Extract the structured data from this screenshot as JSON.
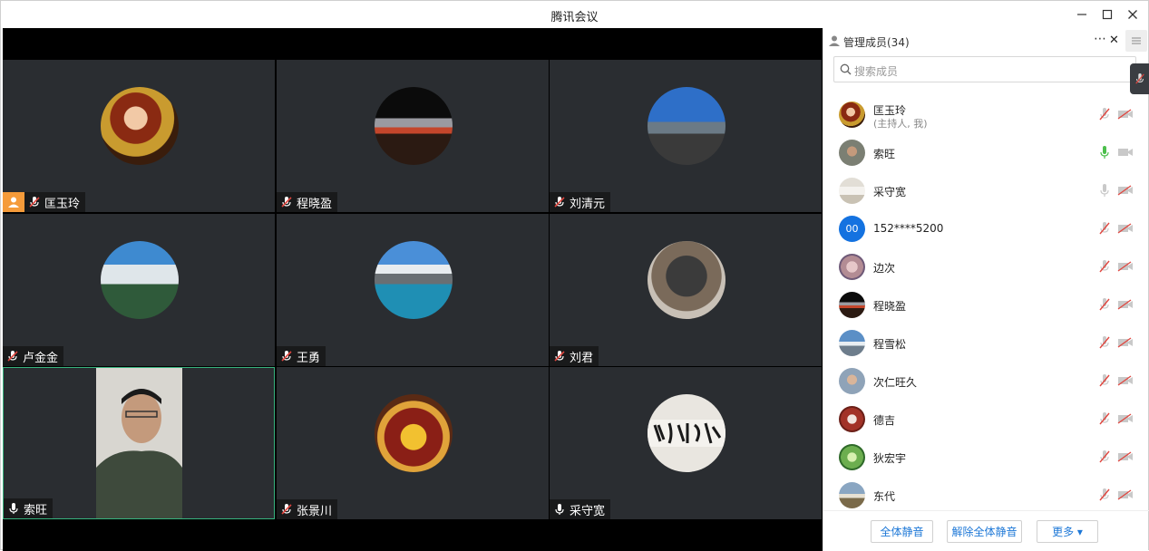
{
  "window": {
    "title": "腾讯会议"
  },
  "tiles": [
    {
      "name": "匡玉玲",
      "host": true,
      "mic": "muted",
      "avatar": "opera-portrait"
    },
    {
      "name": "程晓盈",
      "host": false,
      "mic": "muted",
      "avatar": "palace-night"
    },
    {
      "name": "刘清元",
      "host": false,
      "mic": "muted",
      "avatar": "yak-lake"
    },
    {
      "name": "卢金金",
      "host": false,
      "mic": "muted",
      "avatar": "mountain-waterfall"
    },
    {
      "name": "王勇",
      "host": false,
      "mic": "muted",
      "avatar": "glacier-lake"
    },
    {
      "name": "刘君",
      "host": false,
      "mic": "muted",
      "avatar": "bronze-statue"
    },
    {
      "name": "索旺",
      "host": false,
      "mic": "on",
      "avatar": "live-video",
      "active": true
    },
    {
      "name": "张景川",
      "host": false,
      "mic": "muted",
      "avatar": "buddha-figure"
    },
    {
      "name": "采守宽",
      "host": false,
      "mic": "on",
      "avatar": "calligraphy"
    }
  ],
  "panel": {
    "title": "管理成员(34)",
    "more_label": "⋯",
    "close_label": "✕",
    "search_placeholder": "搜索成员",
    "members": [
      {
        "name": "匡玉玲",
        "sub": "(主持人, 我)",
        "mic": "muted",
        "avatar_color": "#6a3a1e"
      },
      {
        "name": "索旺",
        "sub": "",
        "mic": "active",
        "avatar_color": "#7b7f73"
      },
      {
        "name": "采守宽",
        "sub": "",
        "mic": "off-gray",
        "avatar_color": "#c9c2b4"
      },
      {
        "name": "152****5200",
        "sub": "",
        "mic": "muted",
        "avatar_color": "#1472e0",
        "avatar_text": "00"
      },
      {
        "name": "边次",
        "sub": "",
        "mic": "muted",
        "avatar_color": "#b38c94"
      },
      {
        "name": "程晓盈",
        "sub": "",
        "mic": "muted",
        "avatar_color": "#3b2a22"
      },
      {
        "name": "程雪松",
        "sub": "",
        "mic": "muted",
        "avatar_color": "#5b8fc6"
      },
      {
        "name": "次仁旺久",
        "sub": "",
        "mic": "muted",
        "avatar_color": "#8fa3b8"
      },
      {
        "name": "德吉",
        "sub": "",
        "mic": "muted",
        "avatar_color": "#a23328"
      },
      {
        "name": "狄宏宇",
        "sub": "",
        "mic": "muted",
        "avatar_color": "#6cae4f"
      },
      {
        "name": "东代",
        "sub": "",
        "mic": "muted",
        "avatar_color": "#8aa6c2"
      }
    ],
    "footer": {
      "mute_all": "全体静音",
      "unmute_all": "解除全体静音",
      "more": "更多 ▾"
    }
  },
  "colors": {
    "accent": "#1e78d7",
    "host_badge": "#f59b3a",
    "active_border": "#37b37e",
    "mic_active": "#4cbf4c",
    "mic_muted": "#e0463f"
  }
}
